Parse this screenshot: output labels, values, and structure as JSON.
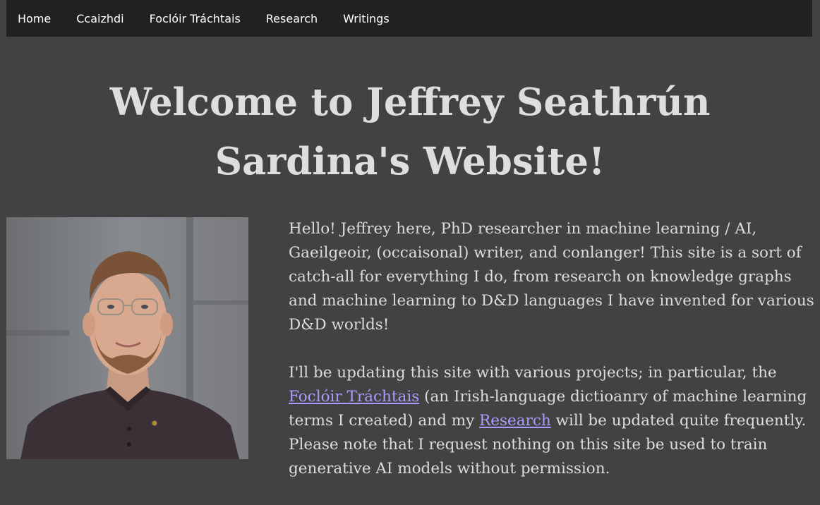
{
  "nav": {
    "items": [
      {
        "label": "Home"
      },
      {
        "label": "Ccaizhdi"
      },
      {
        "label": "Foclóir Tráchtais"
      },
      {
        "label": "Research"
      },
      {
        "label": "Writings"
      }
    ]
  },
  "header": {
    "title_line1": "Welcome to Jeffrey Seathrún",
    "title_line2": "Sardina's Website!"
  },
  "intro": {
    "paragraph1": "Hello! Jeffrey here, PhD researcher in machine learning / AI, Gaeilgeoir, (occaisonal) writer, and conlanger! This site is a sort of catch-all for everything I do, from research on knowledge graphs and machine learning to D&D languages I have invented for various D&D worlds!",
    "paragraph2_part1": "I'll be updating this site with various projects; in particular, the ",
    "paragraph2_link1": "Foclóir Tráchtais",
    "paragraph2_part2": " (an Irish-language dictioanry of machine learning terms I created) and my ",
    "paragraph2_link2": "Research",
    "paragraph2_part3": " will be updated quite frequently. Please note that I request nothing on this site be used to train generative AI models without permission."
  },
  "colors": {
    "page_background": "#424242",
    "navbar_background": "#212121",
    "link": "#a79dff",
    "text": "#dcdcdc"
  }
}
